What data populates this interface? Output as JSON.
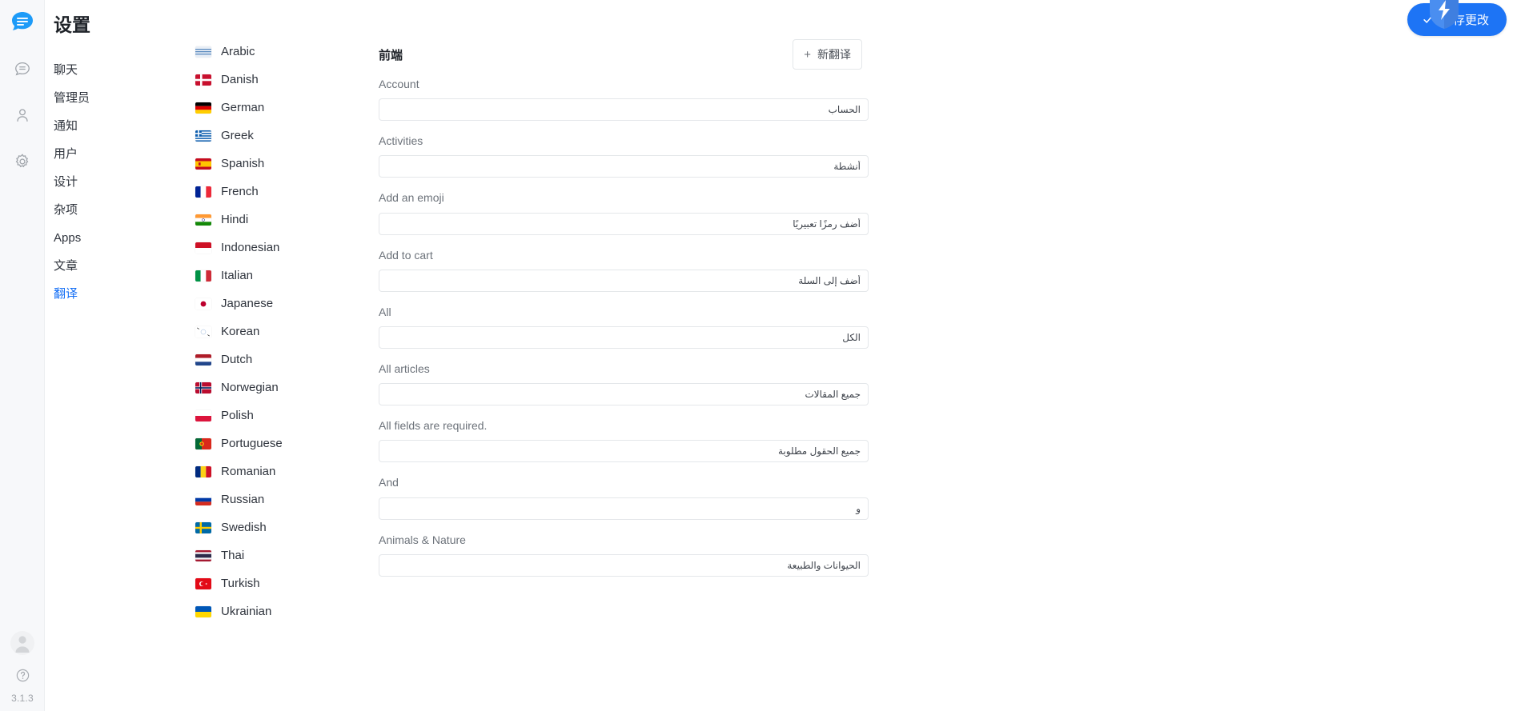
{
  "app": {
    "version": "3.1.3",
    "accent_color": "#156ff5",
    "save_button_color": "#1d74f5"
  },
  "rail": {
    "logo_icon": "chat-bubble-logo",
    "icons": [
      {
        "name": "chat-icon"
      },
      {
        "name": "user-icon"
      },
      {
        "name": "gear-icon"
      }
    ],
    "avatar_icon": "user-avatar",
    "help_icon": "help-circle-icon",
    "version_label": "3.1.3"
  },
  "settings": {
    "title": "设置",
    "nav": [
      {
        "label": "聊天",
        "active": false
      },
      {
        "label": "管理员",
        "active": false
      },
      {
        "label": "通知",
        "active": false
      },
      {
        "label": "用户",
        "active": false
      },
      {
        "label": "设计",
        "active": false
      },
      {
        "label": "杂项",
        "active": false
      },
      {
        "label": "Apps",
        "active": false
      },
      {
        "label": "文章",
        "active": false
      },
      {
        "label": "翻译",
        "active": true
      }
    ]
  },
  "languages": [
    {
      "label": "Arabic",
      "flag": "sa"
    },
    {
      "label": "Danish",
      "flag": "dk"
    },
    {
      "label": "German",
      "flag": "de"
    },
    {
      "label": "Greek",
      "flag": "gr"
    },
    {
      "label": "Spanish",
      "flag": "es"
    },
    {
      "label": "French",
      "flag": "fr"
    },
    {
      "label": "Hindi",
      "flag": "in"
    },
    {
      "label": "Indonesian",
      "flag": "id"
    },
    {
      "label": "Italian",
      "flag": "it"
    },
    {
      "label": "Japanese",
      "flag": "jp"
    },
    {
      "label": "Korean",
      "flag": "kr"
    },
    {
      "label": "Dutch",
      "flag": "nl"
    },
    {
      "label": "Norwegian",
      "flag": "no"
    },
    {
      "label": "Polish",
      "flag": "pl"
    },
    {
      "label": "Portuguese",
      "flag": "pt"
    },
    {
      "label": "Romanian",
      "flag": "ro"
    },
    {
      "label": "Russian",
      "flag": "ru"
    },
    {
      "label": "Swedish",
      "flag": "se"
    },
    {
      "label": "Thai",
      "flag": "th"
    },
    {
      "label": "Turkish",
      "flag": "tr"
    },
    {
      "label": "Ukrainian",
      "flag": "ua"
    }
  ],
  "main": {
    "section_title": "前端",
    "new_translation_label": "新翻译",
    "new_translation_icon": "plus-icon",
    "fields": [
      {
        "label": "Account",
        "value": "الحساب"
      },
      {
        "label": "Activities",
        "value": "أنشطة"
      },
      {
        "label": "Add an emoji",
        "value": "أضف رمزًا تعبيريًا"
      },
      {
        "label": "Add to cart",
        "value": "أضف إلى السلة"
      },
      {
        "label": "All",
        "value": "الكل"
      },
      {
        "label": "All articles",
        "value": "جميع المقالات"
      },
      {
        "label": "All fields are required.",
        "value": "جميع الحقول مطلوبة"
      },
      {
        "label": "And",
        "value": "و"
      },
      {
        "label": "Animals & Nature",
        "value": "الحيوانات والطبيعة"
      }
    ]
  },
  "save": {
    "label": "保存更改",
    "check_icon": "check-icon",
    "overlay_icon": "shield-badge-icon"
  }
}
